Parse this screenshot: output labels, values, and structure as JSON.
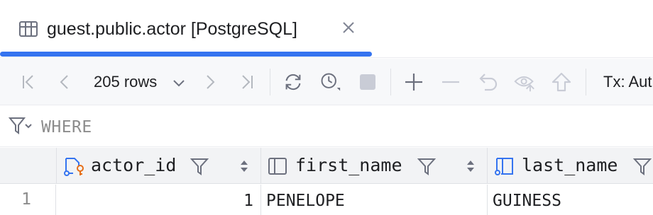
{
  "tab": {
    "title": "guest.public.actor [PostgreSQL]",
    "accent_color": "#3574f0",
    "icon": "table-icon"
  },
  "toolbar": {
    "rows_label": "205 rows",
    "tx_label": "Tx: Aut",
    "buttons": [
      "first-page-icon",
      "previous-page-icon",
      "next-page-icon",
      "last-page-icon",
      "refresh-icon",
      "history-icon",
      "stop-icon",
      "add-row-icon",
      "delete-row-icon",
      "revert-icon",
      "preview-changes-icon",
      "submit-icon"
    ]
  },
  "where": {
    "label": "WHERE"
  },
  "columns": [
    {
      "name": "actor_id",
      "icon": "primary-key-column-icon"
    },
    {
      "name": "first_name",
      "icon": "column-icon"
    },
    {
      "name": "last_name",
      "icon": "column-icon"
    }
  ],
  "rows": [
    {
      "num": "1",
      "actor_id": "1",
      "first_name": "PENELOPE",
      "last_name": "GUINESS"
    }
  ]
}
